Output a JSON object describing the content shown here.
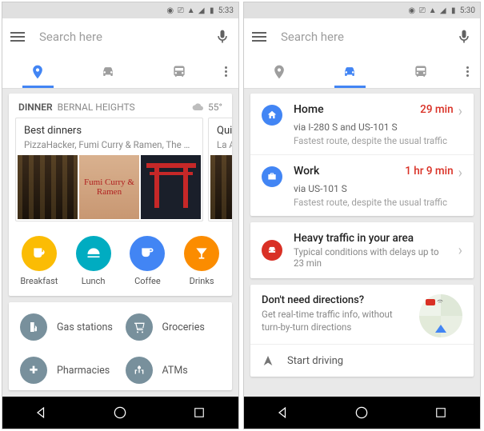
{
  "status": {
    "time_left": "5:33",
    "time_right": "5:30"
  },
  "search": {
    "placeholder": "Search here"
  },
  "colors": {
    "blue": "#4285f4",
    "red": "#d93025",
    "orange": "#fb8c00",
    "amber": "#fbbc04",
    "teal": "#00acc1",
    "bluegrey": "#78909c"
  },
  "left": {
    "dinner": {
      "category": "DINNER",
      "location": "BERNAL HEIGHTS",
      "temp": "55°"
    },
    "bestdinners": {
      "title": "Best dinners",
      "subtitle": "PizzaHacker, Fumi Curry & Ramen, The Front...",
      "ramen_sign": "Fumi Curry & Ramen"
    },
    "quick": {
      "title": "Quick",
      "subtitle": "La Alt"
    },
    "cats": {
      "breakfast": "Breakfast",
      "lunch": "Lunch",
      "coffee": "Coffee",
      "drinks": "Drinks"
    },
    "svcs": {
      "gas": "Gas stations",
      "groceries": "Groceries",
      "pharmacies": "Pharmacies",
      "atms": "ATMs"
    }
  },
  "right": {
    "home": {
      "title": "Home",
      "time": "29 min",
      "via": "via I-280 S and US-101 S",
      "note": "Fastest route, despite the usual traffic"
    },
    "work": {
      "title": "Work",
      "time": "1 hr 9 min",
      "via": "via US-101 S",
      "note": "Fastest route, despite the usual traffic"
    },
    "traffic": {
      "title": "Heavy traffic in your area",
      "sub": "Typical conditions with delays up to 23 min"
    },
    "nodi": {
      "title": "Don't need directions?",
      "sub": "Get real-time traffic info, without turn-by-turn directions"
    },
    "start": "Start driving"
  }
}
